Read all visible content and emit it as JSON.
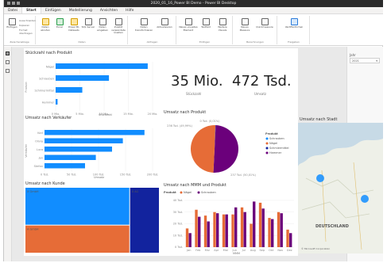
{
  "window": {
    "title": "2020_01_16_Power BI Demo - Power BI Desktop"
  },
  "menu": {
    "tabs": [
      "Datei",
      "Start",
      "Einfügen",
      "Modellierung",
      "Ansichten",
      "Hilfe"
    ]
  },
  "ribbon": {
    "buttons": [
      {
        "label": "Einfügen",
        "icon": "paste-icon"
      },
      {
        "label": "Ausschneiden",
        "icon": "scissors-icon"
      },
      {
        "label": "Kopieren",
        "icon": "copy-icon"
      },
      {
        "label": "Format übertragen",
        "icon": "format-painter-icon"
      },
      {
        "label": "Daten abrufen",
        "icon": "get-data-icon"
      },
      {
        "label": "Excel",
        "icon": "excel-icon"
      },
      {
        "label": "Power BI-Datasets",
        "icon": "dataset-icon"
      },
      {
        "label": "SQL Server",
        "icon": "sql-icon"
      },
      {
        "label": "Daten eingeben",
        "icon": "enter-data-icon"
      },
      {
        "label": "Zuletzt verwendete Quellen",
        "icon": "recent-sources-icon"
      },
      {
        "label": "Daten transformieren",
        "icon": "transform-icon"
      },
      {
        "label": "Aktualisieren",
        "icon": "refresh-icon"
      },
      {
        "label": "Neues visuelles Element",
        "icon": "new-visual-icon"
      },
      {
        "label": "Textfeld",
        "icon": "textbox-icon"
      },
      {
        "label": "Weitere Visuals",
        "icon": "more-visuals-icon"
      },
      {
        "label": "Neues Measure",
        "icon": "measure-icon"
      },
      {
        "label": "Quickmeasure",
        "icon": "quick-measure-icon"
      },
      {
        "label": "Veröffentlichen",
        "icon": "publish-icon"
      }
    ],
    "groups": [
      "Zwischenablage",
      "Daten",
      "Abfragen",
      "Einfügen",
      "Berechnungen",
      "Freigeben"
    ]
  },
  "slicer": {
    "label": "Jahr",
    "value": "2021"
  },
  "visuals": {
    "stueckzahl_title": "Stückzahl nach Produkt",
    "kpi1_value": "35 Mio.",
    "kpi1_label": "Stückzahl",
    "kpi2_value": "472 Tsd.",
    "kpi2_label": "Umsatz",
    "verkaeufer_title": "Umsatz nach Verkäufer",
    "pie_title": "Umsatz nach Produkt",
    "map_title": "Umsatz nach Stadt",
    "treemap_title": "Umsatz nach Kunde",
    "combo_title": "Umsatz nach MMM und Produkt",
    "stueck_xlabel": "Stückzahl",
    "stueck_ylabel": "Produkt",
    "verk_xlabel": "Umsatz",
    "verk_ylabel": "Verkäufer",
    "combo_xlabel": "MMM"
  },
  "map": {
    "country_label": "DEUTSCHLAND",
    "attribution": "© Microsoft Corporation"
  },
  "colors": {
    "blue": "#118dff",
    "orange": "#e66c37",
    "purple": "#6b007b",
    "navy": "#12239e",
    "accent": "#f2c80f"
  },
  "chart_data": [
    {
      "type": "bar",
      "orientation": "horizontal",
      "title": "Stückzahl nach Produkt",
      "categories": [
        "Nägel",
        "Schrauben",
        "Schmiermittel",
        "Hammer"
      ],
      "values": [
        19000000,
        11000000,
        5500000,
        400000
      ],
      "xlabel": "Stückzahl",
      "ylabel": "Produkt",
      "xticks": [
        "0 Mio.",
        "5 Mio.",
        "10 Mio.",
        "15 Mio.",
        "20 Mio."
      ],
      "xlim": [
        0,
        20000000
      ]
    },
    {
      "type": "bar",
      "orientation": "horizontal",
      "title": "Umsatz nach Verkäufer",
      "categories": [
        "Karl",
        "Olivia",
        "Luca",
        "Jan",
        "Stefan"
      ],
      "values": [
        185000,
        145000,
        125000,
        95000,
        75000
      ],
      "xlabel": "Umsatz",
      "ylabel": "Verkäufer",
      "xticks": [
        "0 Tsd.",
        "50 Tsd.",
        "100 Tsd.",
        "150 Tsd.",
        "200 Tsd."
      ],
      "xlim": [
        0,
        200000
      ]
    },
    {
      "type": "pie",
      "title": "Umsatz nach Produkt",
      "legend_title": "Produkt",
      "categories": [
        "Schrauben",
        "Nägel",
        "Schmiermittel",
        "Hammer"
      ],
      "values": [
        236000,
        235000,
        800,
        200
      ],
      "data_labels": [
        "236 Tsd. (49,99%)",
        "237 Tsd. (50,01%)",
        "0 Tsd. (0,01%)"
      ]
    },
    {
      "type": "treemap",
      "title": "Umsatz nach Kunde",
      "categories": [
        "X GmbH",
        "A GmbH",
        "X AG"
      ],
      "values": [
        215000,
        155000,
        102000
      ]
    },
    {
      "type": "bar",
      "title": "Umsatz nach MMM und Produkt",
      "categories": [
        "Jan",
        "Feb",
        "Mrz",
        "Apr",
        "Mai",
        "Jun",
        "Jul",
        "Aug",
        "Sep",
        "Okt",
        "Nov",
        "Dez"
      ],
      "series": [
        {
          "name": "Nägel",
          "values": [
            16000,
            32000,
            27000,
            30000,
            28000,
            28000,
            34000,
            20000,
            38000,
            25000,
            30000,
            15000
          ]
        },
        {
          "name": "Schrauben",
          "values": [
            12000,
            26000,
            22000,
            29000,
            28000,
            34000,
            30000,
            39000,
            33000,
            24000,
            29000,
            12000
          ]
        }
      ],
      "legend_title": "Produkt",
      "yticks": [
        "0 Tsd.",
        "10 Tsd.",
        "20 Tsd.",
        "30 Tsd.",
        "40 Tsd."
      ],
      "ylim": [
        0,
        42000
      ],
      "xlabel": "MMM"
    }
  ]
}
